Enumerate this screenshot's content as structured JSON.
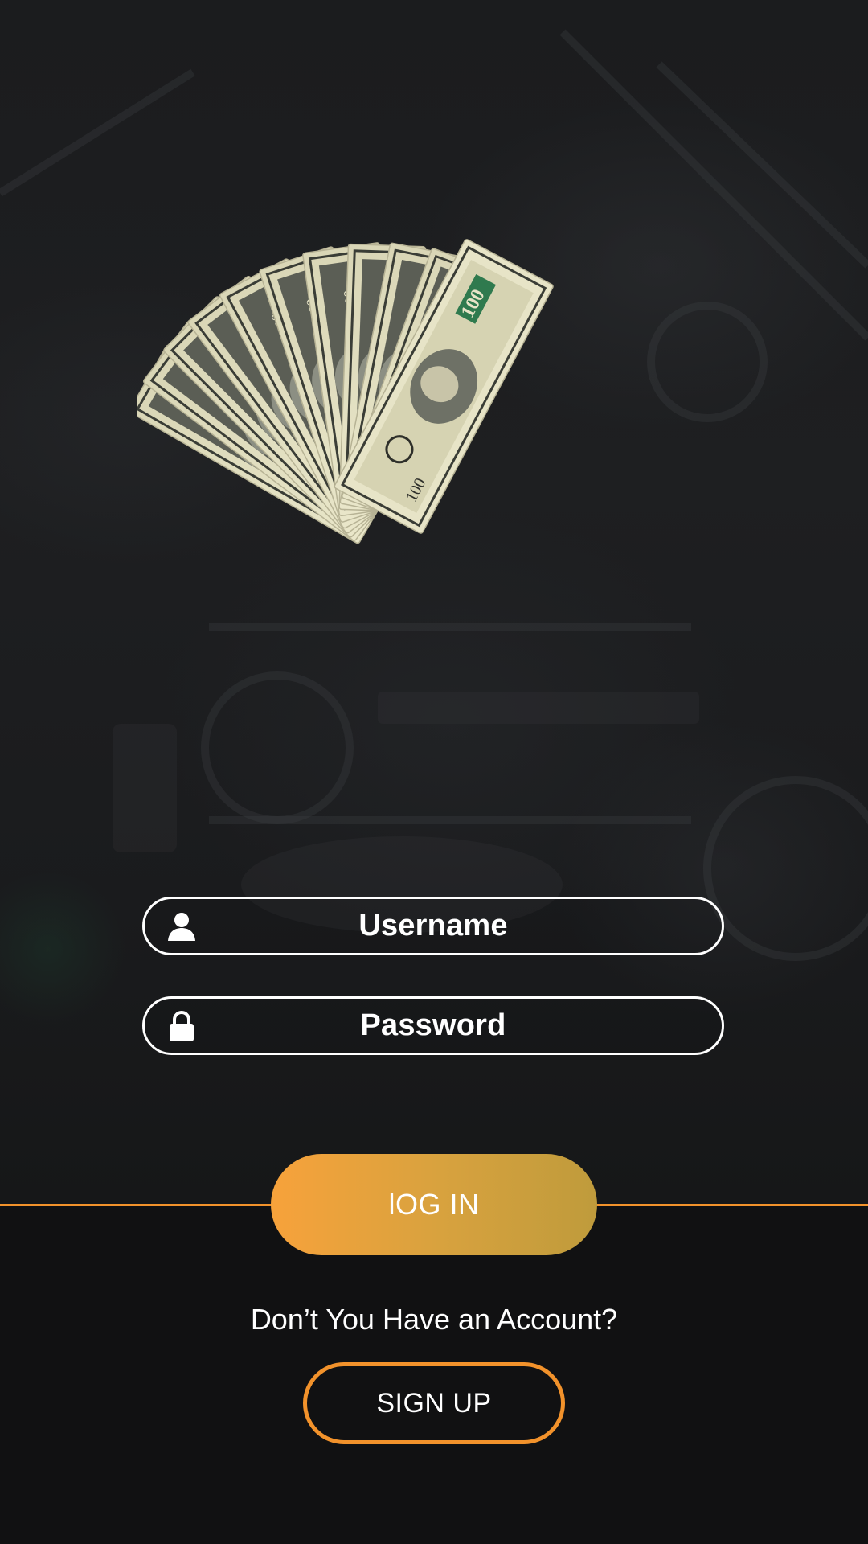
{
  "login_form": {
    "username_placeholder": "Username",
    "password_placeholder": "Password",
    "username_icon": "user-icon",
    "password_icon": "lock-icon"
  },
  "actions": {
    "login_label": "lOG IN",
    "signup_prompt": "Don’t You Have an Account?",
    "signup_label": "SIGN UP"
  },
  "hero": {
    "image": "fanned-hundred-dollar-bills"
  },
  "colors": {
    "background": "#111112",
    "accent_orange": "#f2922b",
    "login_gradient_start": "#f7a23b",
    "login_gradient_end": "#bf9b3c",
    "text": "#ffffff",
    "bill": "#e6e3c6"
  }
}
